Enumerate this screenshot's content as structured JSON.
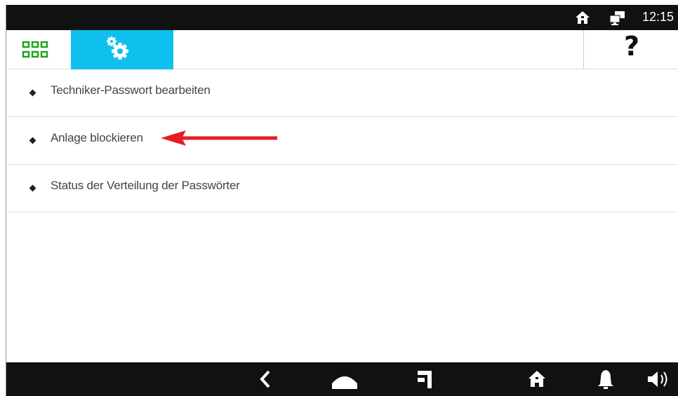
{
  "status_bar": {
    "time": "12:15",
    "icons": [
      "home-icon",
      "network-icon"
    ]
  },
  "toolbar": {
    "apps_icon": "grid-icon",
    "settings_icon": "gears-icon",
    "help_label": "?",
    "colors": {
      "active_tab": "#0fc0ee",
      "apps_icon": "#1aa31a"
    }
  },
  "menu": {
    "items": [
      {
        "label": "Techniker-Passwort bearbeiten"
      },
      {
        "label": "Anlage blockieren"
      },
      {
        "label": "Status der Verteilung der Passwörter"
      }
    ]
  },
  "annotation": {
    "icon": "red-arrow",
    "color": "#e31e24"
  },
  "nav_bar": {
    "icons": [
      "back-icon",
      "home-icon",
      "recents-icon",
      "house-icon",
      "bell-icon",
      "speaker-icon"
    ]
  }
}
